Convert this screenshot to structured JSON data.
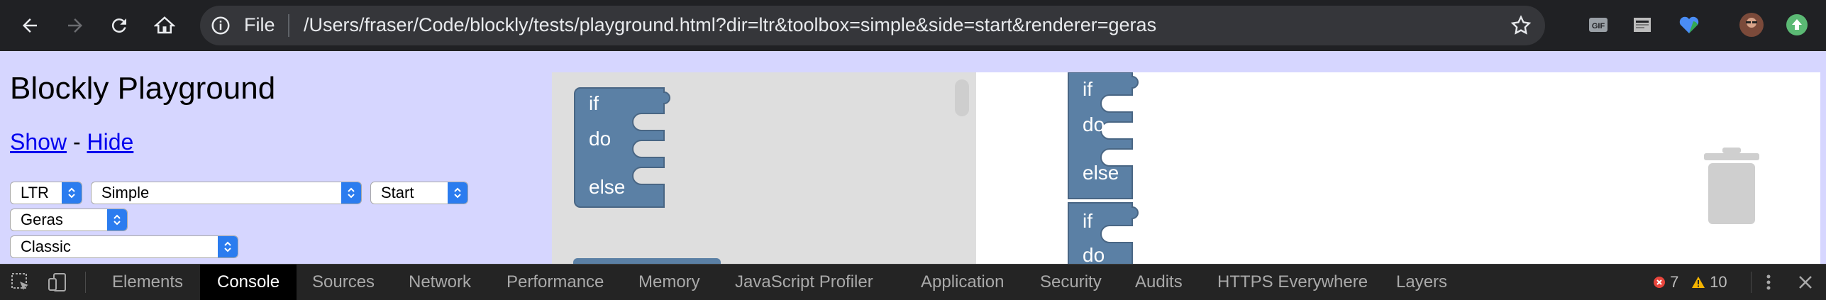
{
  "browser": {
    "url_scheme": "File",
    "url": "/Users/fraser/Code/blockly/tests/playground.html?dir=ltr&toolbox=simple&side=start&renderer=geras",
    "colors": {
      "frame": "#202124",
      "omnibox": "#35363a",
      "text": "#e8eaed"
    },
    "extension_icons": [
      "gif-icon",
      "reader-icon",
      "heart-icon",
      "avatar",
      "update-icon"
    ]
  },
  "page": {
    "title": "Blockly Playground",
    "show_link": "Show",
    "separator": "-",
    "hide_link": "Hide",
    "selects": {
      "direction": "LTR",
      "toolbox": "Simple",
      "side": "Start",
      "renderer": "Geras",
      "theme": "Classic"
    },
    "background": "#d6d6ff"
  },
  "blockly": {
    "block_color": "#5b80a5",
    "flyout_block": {
      "if": "if",
      "do": "do",
      "else": "else"
    },
    "workspace_block_1": {
      "if": "if",
      "do": "do",
      "else": "else"
    },
    "workspace_block_2": {
      "if": "if",
      "do": "do"
    }
  },
  "devtools": {
    "tabs": [
      "Elements",
      "Console",
      "Sources",
      "Network",
      "Performance",
      "Memory",
      "JavaScript Profiler",
      "Application",
      "Security",
      "Audits",
      "HTTPS Everywhere",
      "Layers"
    ],
    "active_tab": "Console",
    "errors": "7",
    "warnings": "10",
    "colors": {
      "error": "#e8453c",
      "warning": "#f5b400"
    }
  }
}
